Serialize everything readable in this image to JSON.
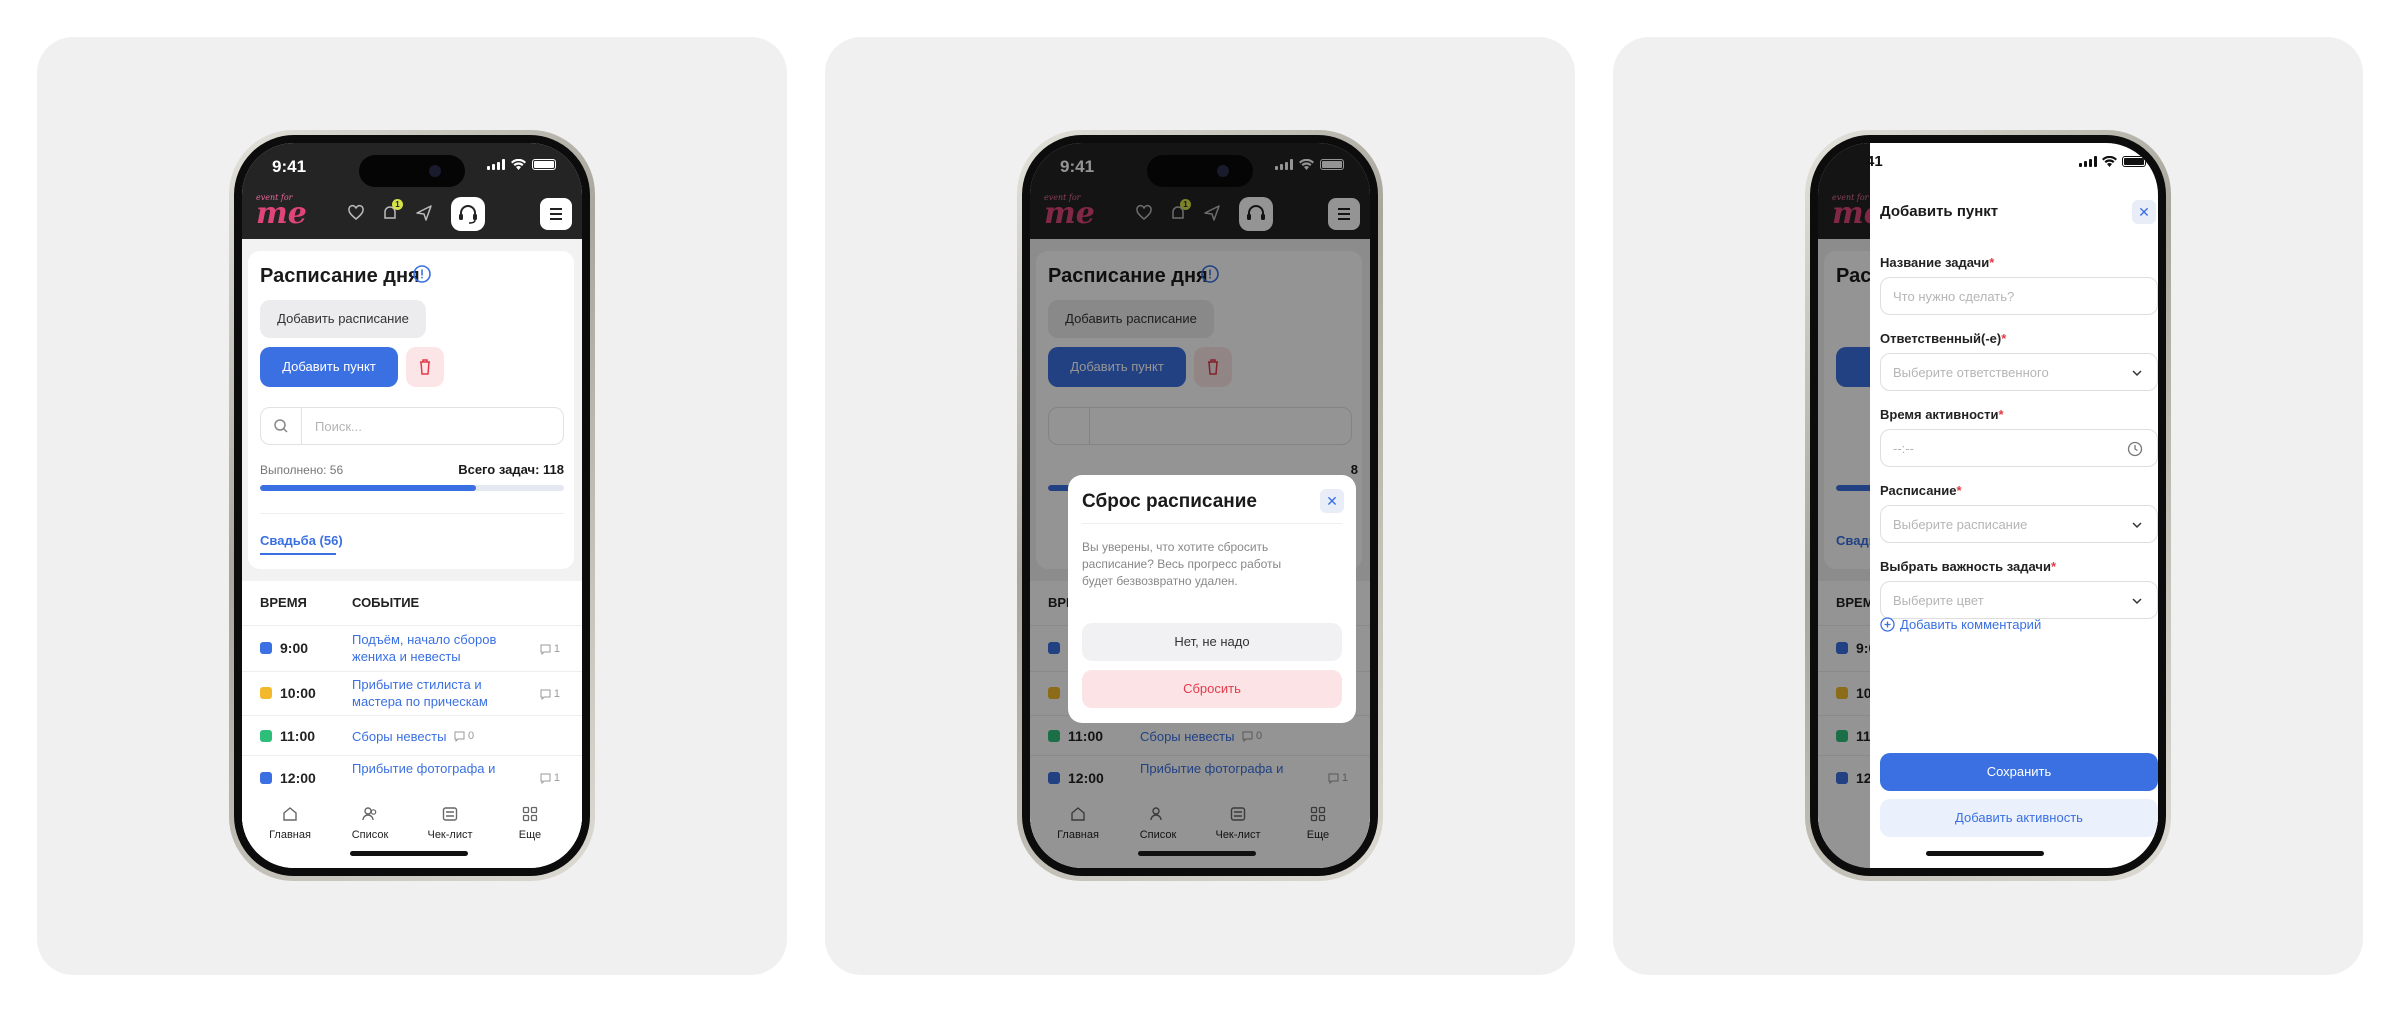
{
  "status": {
    "time": "9:41",
    "drawer_time": "41"
  },
  "header": {
    "logo_small": "event for",
    "logo_big": "me",
    "notifications_count": "1"
  },
  "schedule": {
    "title": "Расписание дня",
    "add_schedule_label": "Добавить расписание",
    "add_item_label": "Добавить пункт",
    "search_placeholder": "Поиск...",
    "done_label": "Выполнено: 56",
    "total_label": "Всего задач: 118",
    "progress_fraction": 0.71,
    "tab_label": "Свадьба (56)",
    "col_time": "ВРЕМЯ",
    "col_event": "СОБЫТИЕ",
    "rows": [
      {
        "time": "9:00",
        "event": "Подъём, начало сборов жениха и невесты",
        "comments": "1",
        "color": "#3a70e2"
      },
      {
        "time": "10:00",
        "event": "Прибытие стилиста и мастера по прическам",
        "comments": "1",
        "color": "#f2b92c"
      },
      {
        "time": "11:00",
        "event": "Сборы невесты",
        "comments": "0",
        "color": "#2dbf7a"
      },
      {
        "time": "12:00",
        "event": "Прибытие фотографа и",
        "comments": "1",
        "color": "#3a70e2"
      }
    ]
  },
  "nav": {
    "home": "Главная",
    "list": "Список",
    "checklist": "Чек-лист",
    "more": "Еще"
  },
  "modal": {
    "title": "Сброс расписание",
    "text": "Вы уверены, что хотите сбросить расписание? Весь прогресс работы будет безвозвратно удален.",
    "cancel_label": "Нет, не надо",
    "reset_label": "Сбросить",
    "partial_total": "8"
  },
  "drawer": {
    "title": "Добавить пункт",
    "task_name_label": "Название задачи",
    "task_name_placeholder": "Что нужно сделать?",
    "responsible_label": "Ответственный(-е)",
    "responsible_placeholder": "Выберите ответственного",
    "activity_time_label": "Время активности",
    "activity_time_placeholder": "--:--",
    "schedule_label": "Расписание",
    "schedule_placeholder": "Выберите расписание",
    "importance_label": "Выбрать важность задачи",
    "importance_placeholder": "Выберите цвет",
    "add_comment_label": "Добавить комментарий",
    "save_label": "Сохранить",
    "add_activity_label": "Добавить активность",
    "required_mark": "*"
  },
  "colors": {
    "accent": "#3a70e2",
    "danger": "#e23a4a",
    "header": "#242424",
    "logo": "#e0457a"
  }
}
